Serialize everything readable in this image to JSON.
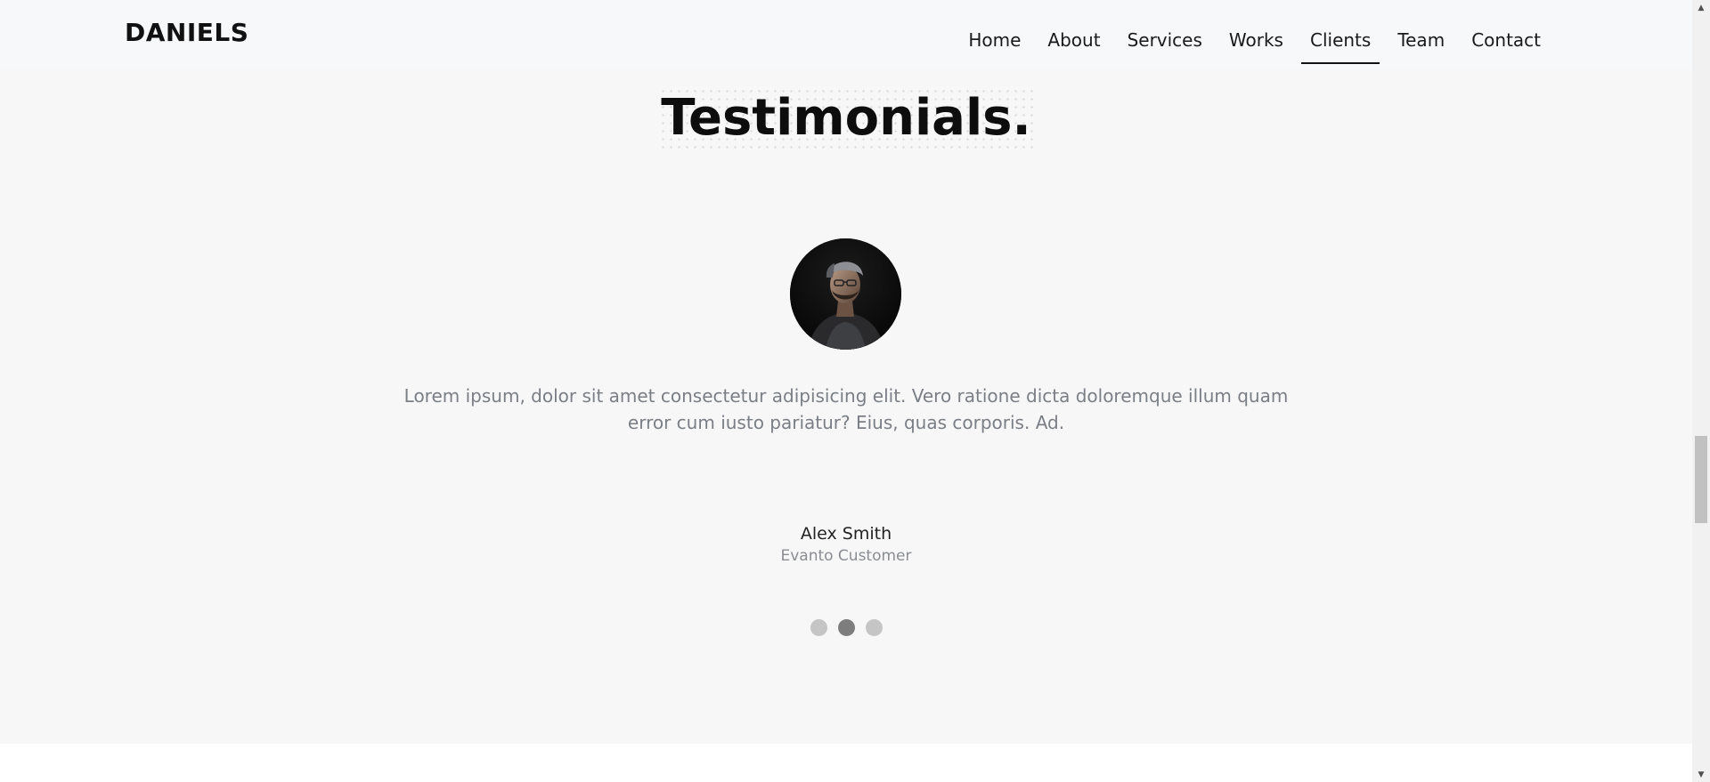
{
  "header": {
    "brand": "DANIELS",
    "nav": [
      {
        "label": "Home",
        "active": false
      },
      {
        "label": "About",
        "active": false
      },
      {
        "label": "Services",
        "active": false
      },
      {
        "label": "Works",
        "active": false
      },
      {
        "label": "Clients",
        "active": true
      },
      {
        "label": "Team",
        "active": false
      },
      {
        "label": "Contact",
        "active": false
      }
    ]
  },
  "testimonials": {
    "title": "Testimonials.",
    "quote": "Lorem ipsum, dolor sit amet consectetur adipisicing elit. Vero ratione dicta doloremque illum quam error cum iusto pariatur? Eius, quas corporis. Ad.",
    "author_name": "Alex Smith",
    "author_role": "Evanto Customer",
    "slides_total": 3,
    "active_slide": 2
  },
  "colors": {
    "accent": "#111111",
    "section_bg": "#f7f7f7",
    "quote_text": "#7a7e85",
    "dot_inactive": "#c5c5c5",
    "dot_active": "#7d7d7d"
  },
  "icons": {
    "scroll_up": "▲",
    "scroll_down": "▼"
  }
}
